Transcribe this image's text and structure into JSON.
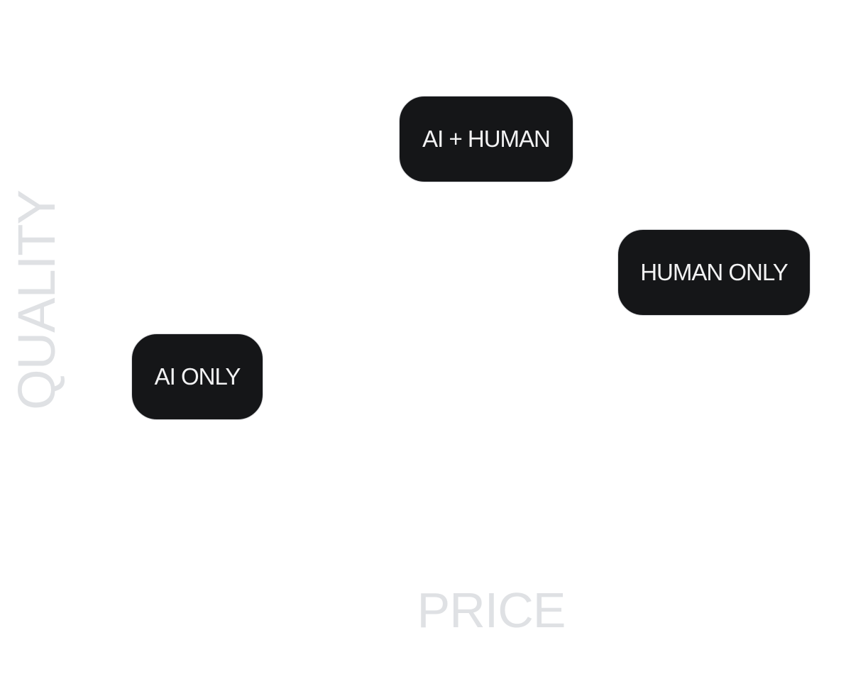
{
  "axes": {
    "y_label": "QUALITY",
    "x_label": "PRICE"
  },
  "nodes": {
    "ai_human": "AI + HUMAN",
    "human_only": "HUMAN ONLY",
    "ai_only": "AI ONLY"
  },
  "colors": {
    "node_fill": "#151618",
    "node_text": "#f2f2f3",
    "node_border": "#d9dadd",
    "axis_label": "#dfe1e4",
    "background": "#ffffff"
  }
}
